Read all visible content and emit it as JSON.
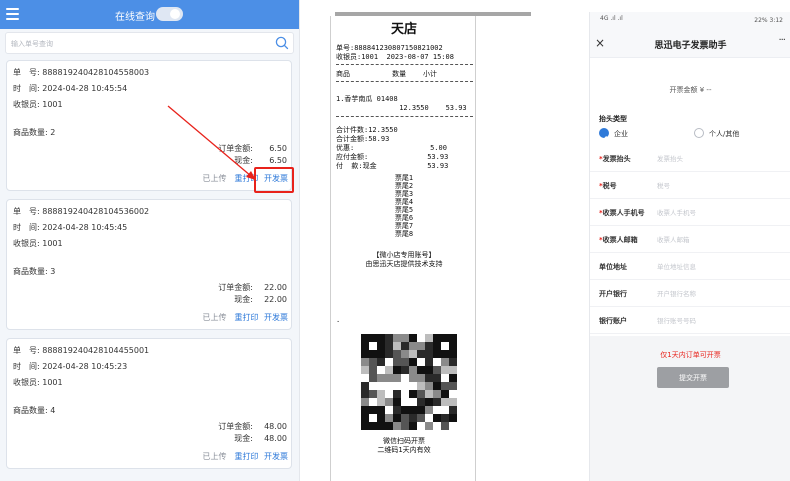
{
  "left": {
    "header_title": "在线查询",
    "toggle_text": "",
    "search_placeholder": "输入单号查询",
    "orders": [
      {
        "order_no_label": "单　号:",
        "order_no": "888819240428104558003",
        "time_label": "时　间:",
        "time": "2024-04-28 10:45:54",
        "cashier_label": "收银员:",
        "cashier": "1001",
        "qty_label": "商品数量:",
        "qty": "2",
        "order_amount_label": "订单金额:",
        "order_amount": "6.50",
        "cash_label": "现金:",
        "cash": "6.50",
        "status": "已上传",
        "reprint": "重打印",
        "invoice": "开发票"
      },
      {
        "order_no_label": "单　号:",
        "order_no": "888819240428104536002",
        "time_label": "时　间:",
        "time": "2024-04-28 10:45:45",
        "cashier_label": "收银员:",
        "cashier": "1001",
        "qty_label": "商品数量:",
        "qty": "3",
        "order_amount_label": "订单金额:",
        "order_amount": "22.00",
        "cash_label": "现金:",
        "cash": "22.00",
        "status": "已上传",
        "reprint": "重打印",
        "invoice": "开发票"
      },
      {
        "order_no_label": "单　号:",
        "order_no": "888819240428104455001",
        "time_label": "时　间:",
        "time": "2024-04-28 10:45:23",
        "cashier_label": "收银员:",
        "cashier": "1001",
        "qty_label": "商品数量:",
        "qty": "4",
        "order_amount_label": "订单金额:",
        "order_amount": "48.00",
        "cash_label": "现金:",
        "cash": "48.00",
        "status": "已上传",
        "reprint": "重打印",
        "invoice": "开发票"
      }
    ]
  },
  "receipt": {
    "title": "天店",
    "order_line": "单号:888841230807150821002",
    "cashier_line": "收银员:1001  2023-08-07 15:08",
    "col_header": "商品          数量    小计",
    "item_line1": "1.香芋南瓜 01408",
    "item_line2": "               12.3550    53.93",
    "total_qty": "合计件数:12.3550",
    "total_amt": "合计金额:58.93",
    "discount": "优惠:                  5.00",
    "payable": "应付金额:              53.93",
    "paid": "付  款:现金            53.93",
    "tail_lines": [
      "票尾1",
      "票尾2",
      "票尾3",
      "票尾4",
      "票尾5",
      "票尾6",
      "票尾7",
      "票尾8"
    ],
    "store_account": "【微小店专用账号】",
    "tech_support": "由思迅天店提供技术支持",
    "dot": ".",
    "scan_text": "微信扫码开票",
    "valid_text": "二维码1天内有效"
  },
  "phone": {
    "status_left": "4G .ıl .ıl",
    "status_right": "22% 3:12",
    "close": "×",
    "title": "思迅电子发票助手",
    "more": "···",
    "amount_line": "开票金额 ¥ --",
    "header_type_label": "抬头类型",
    "type_company": "企业",
    "type_personal": "个人/其他",
    "fields": [
      {
        "required": "*",
        "label": "发票抬头",
        "placeholder": "发票抬头"
      },
      {
        "required": "*",
        "label": "税号",
        "placeholder": "税号"
      },
      {
        "required": "*",
        "label": "收票人手机号",
        "placeholder": "收票人手机号"
      },
      {
        "required": "*",
        "label": "收票人邮箱",
        "placeholder": "收票人邮箱"
      },
      {
        "required": "",
        "label": "单位地址",
        "placeholder": "单位地址信息"
      },
      {
        "required": "",
        "label": "开户银行",
        "placeholder": "开户银行名称"
      },
      {
        "required": "",
        "label": "银行账户",
        "placeholder": "银行账号号码"
      }
    ],
    "notice": "仅1天内订单可开票",
    "submit": "提交开票"
  },
  "colors": {
    "header_blue": "#4c8fe6",
    "link_blue": "#2f7ad9",
    "highlight_red": "#e8221b",
    "submit_gray": "#9d9fa3"
  }
}
